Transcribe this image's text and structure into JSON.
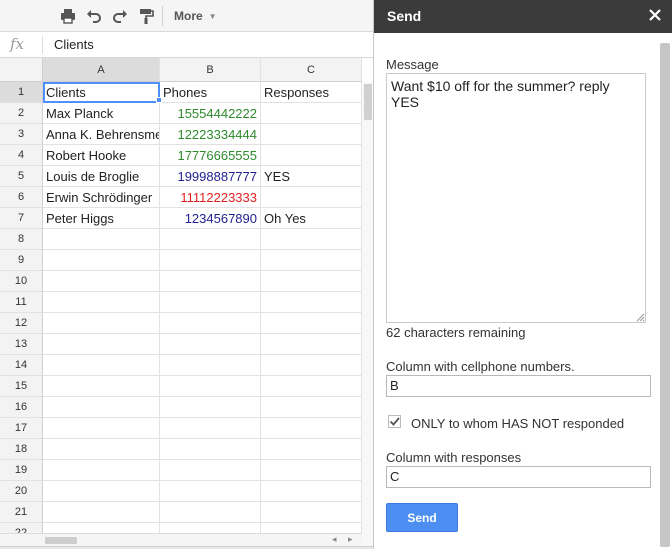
{
  "toolbar": {
    "icons": [
      "print-icon",
      "undo-icon",
      "redo-icon",
      "paint-format-icon"
    ],
    "more_label": "More"
  },
  "formula_bar": {
    "fx_label": "fx",
    "value": "Clients"
  },
  "sheet": {
    "columns": [
      "A",
      "B",
      "C"
    ],
    "rows": [
      {
        "num": "1",
        "a": "Clients",
        "b": "Phones",
        "c": "Responses",
        "b_color": "#222222"
      },
      {
        "num": "2",
        "a": "Max Planck",
        "b": "15554442222",
        "c": "",
        "b_color": "#2e8b2e"
      },
      {
        "num": "3",
        "a": "Anna K. Behrensmeyer",
        "b": "12223334444",
        "c": "",
        "b_color": "#2e8b2e"
      },
      {
        "num": "4",
        "a": "Robert Hooke",
        "b": "17776665555",
        "c": "",
        "b_color": "#2e8b2e"
      },
      {
        "num": "5",
        "a": "Louis de Broglie",
        "b": "19998887777",
        "c": "YES",
        "b_color": "#1f1f8f"
      },
      {
        "num": "6",
        "a": "Erwin Schrödinger",
        "b": "11112223333",
        "c": "",
        "b_color": "#e02020"
      },
      {
        "num": "7",
        "a": "Peter Higgs",
        "b": "1234567890",
        "c": "Oh Yes",
        "b_color": "#1f1f8f"
      },
      {
        "num": "8",
        "a": "",
        "b": "",
        "c": "",
        "b_color": "#222222"
      },
      {
        "num": "9",
        "a": "",
        "b": "",
        "c": "",
        "b_color": "#222222"
      },
      {
        "num": "10",
        "a": "",
        "b": "",
        "c": "",
        "b_color": "#222222"
      },
      {
        "num": "11",
        "a": "",
        "b": "",
        "c": "",
        "b_color": "#222222"
      },
      {
        "num": "12",
        "a": "",
        "b": "",
        "c": "",
        "b_color": "#222222"
      },
      {
        "num": "13",
        "a": "",
        "b": "",
        "c": "",
        "b_color": "#222222"
      },
      {
        "num": "14",
        "a": "",
        "b": "",
        "c": "",
        "b_color": "#222222"
      },
      {
        "num": "15",
        "a": "",
        "b": "",
        "c": "",
        "b_color": "#222222"
      },
      {
        "num": "16",
        "a": "",
        "b": "",
        "c": "",
        "b_color": "#222222"
      },
      {
        "num": "17",
        "a": "",
        "b": "",
        "c": "",
        "b_color": "#222222"
      },
      {
        "num": "18",
        "a": "",
        "b": "",
        "c": "",
        "b_color": "#222222"
      },
      {
        "num": "19",
        "a": "",
        "b": "",
        "c": "",
        "b_color": "#222222"
      },
      {
        "num": "20",
        "a": "",
        "b": "",
        "c": "",
        "b_color": "#222222"
      },
      {
        "num": "21",
        "a": "",
        "b": "",
        "c": "",
        "b_color": "#222222"
      },
      {
        "num": "22",
        "a": "",
        "b": "",
        "c": "",
        "b_color": "#222222"
      }
    ],
    "selected_cell": "A1"
  },
  "sidebar": {
    "title": "Send",
    "message_label": "Message",
    "message_value": "Want $10 off for the summer? reply YES",
    "chars_remaining": "62 characters remaining",
    "phone_column_label": "Column with cellphone numbers.",
    "phone_column_value": "B",
    "only_unresponded_label": "ONLY to whom HAS NOT responded",
    "only_unresponded_checked": true,
    "response_column_label": "Column with responses",
    "response_column_value": "C",
    "send_label": "Send",
    "accent_color": "#4d8ef3",
    "header_color": "#3b3b3b"
  }
}
